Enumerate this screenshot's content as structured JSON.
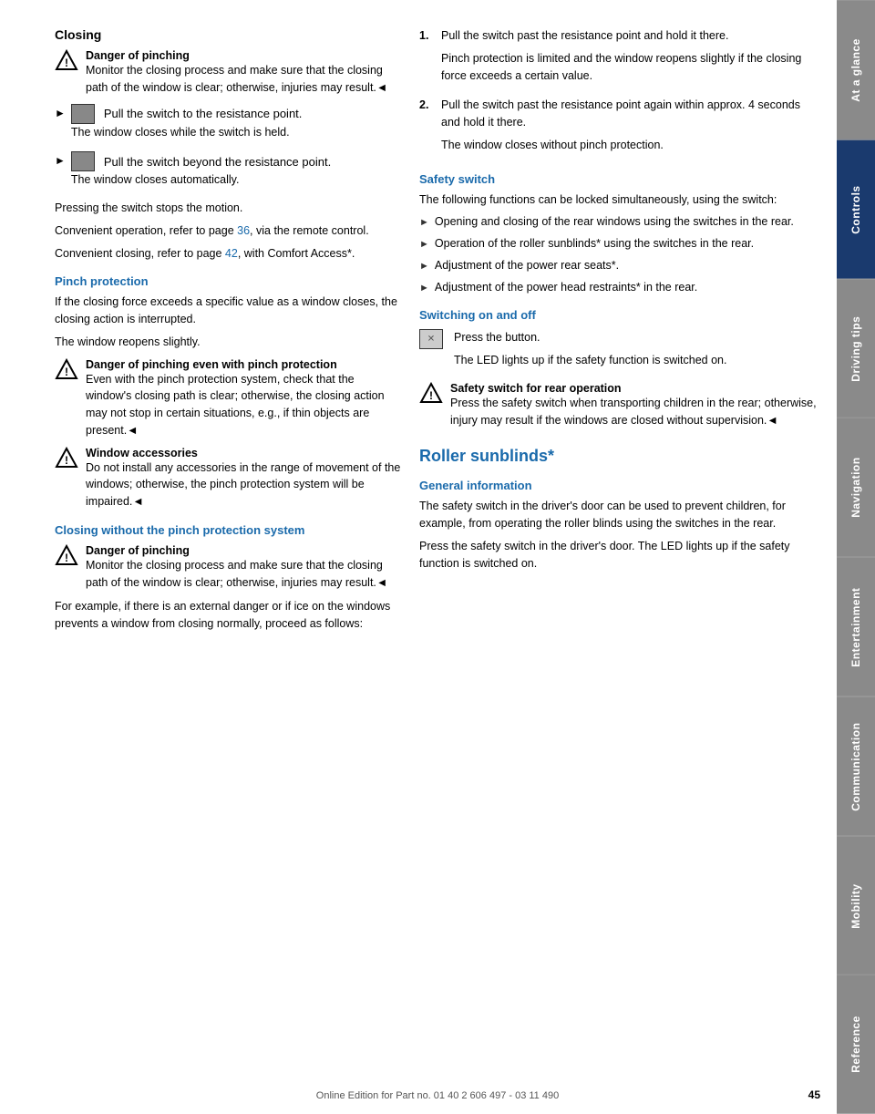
{
  "page": {
    "number": "45",
    "footer_text": "Online Edition for Part no. 01 40 2 606 497 - 03 11 490"
  },
  "sidebar": {
    "tabs": [
      {
        "label": "At a glance",
        "active": false
      },
      {
        "label": "Controls",
        "active": true
      },
      {
        "label": "Driving tips",
        "active": false
      },
      {
        "label": "Navigation",
        "active": false
      },
      {
        "label": "Entertainment",
        "active": false
      },
      {
        "label": "Communication",
        "active": false
      },
      {
        "label": "Mobility",
        "active": false
      },
      {
        "label": "Reference",
        "active": false
      }
    ]
  },
  "left_column": {
    "main_title": "Closing",
    "warning1": {
      "title": "Danger of pinching",
      "body": "Monitor the closing process and make sure that the closing path of the window is clear; otherwise, injuries may result.◄"
    },
    "bullet1": {
      "instruction": "Pull the switch to the resistance point.",
      "sub": "The window closes while the switch is held."
    },
    "bullet2": {
      "instruction": "Pull the switch beyond the resistance point.",
      "sub": "The window closes automatically."
    },
    "press_text": "Pressing the switch stops the motion.",
    "convenient1": "Convenient operation, refer to page 36, via the remote control.",
    "convenient1_page": "36",
    "convenient2": "Convenient closing, refer to page 42, with Comfort Access*.",
    "convenient2_page": "42",
    "pinch_title": "Pinch protection",
    "pinch_p1": "If the closing force exceeds a specific value as a window closes, the closing action is interrupted.",
    "pinch_p2": "The window reopens slightly.",
    "warning2": {
      "title": "Danger of pinching even with pinch protection",
      "body": "Even with the pinch protection system, check that the window's closing path is clear; otherwise, the closing action may not stop in certain situations, e.g., if thin objects are present.◄"
    },
    "warning3": {
      "title": "Window accessories",
      "body": "Do not install any accessories in the range of movement of the windows; otherwise, the pinch protection system will be impaired.◄"
    },
    "closing_nopinch_title": "Closing without the pinch protection system",
    "warning4": {
      "title": "Danger of pinching",
      "body": "Monitor the closing process and make sure that the closing path of the window is clear; otherwise, injuries may result.◄"
    },
    "example_text": "For example, if there is an external danger or if ice on the windows prevents a window from closing normally, proceed as follows:"
  },
  "right_column": {
    "numbered_steps": [
      {
        "num": "1.",
        "main": "Pull the switch past the resistance point and hold it there.",
        "sub": "Pinch protection is limited and the window reopens slightly if the closing force exceeds a certain value."
      },
      {
        "num": "2.",
        "main": "Pull the switch past the resistance point again within approx. 4 seconds and hold it there.",
        "sub": "The window closes without pinch protection."
      }
    ],
    "safety_title": "Safety switch",
    "safety_p1": "The following functions can be locked simultaneously, using the switch:",
    "safety_bullets": [
      "Opening and closing of the rear windows using the switches in the rear.",
      "Operation of the roller sunblinds* using the switches in the rear.",
      "Adjustment of the power rear seats*.",
      "Adjustment of the power head restraints* in the rear."
    ],
    "switching_title": "Switching on and off",
    "switching_p1": "Press the button.",
    "switching_p2": "The LED lights up if the safety function is switched on.",
    "warning5": {
      "title": "Safety switch for rear operation",
      "body": "Press the safety switch when transporting children in the rear; otherwise, injury may result if the windows are closed without supervision.◄"
    },
    "roller_title": "Roller sunblinds*",
    "general_title": "General information",
    "general_p1": "The safety switch in the driver's door can be used to prevent children, for example, from operating the roller blinds using the switches in the rear.",
    "general_p2": "Press the safety switch in the driver's door. The LED lights up if the safety function is switched on."
  }
}
